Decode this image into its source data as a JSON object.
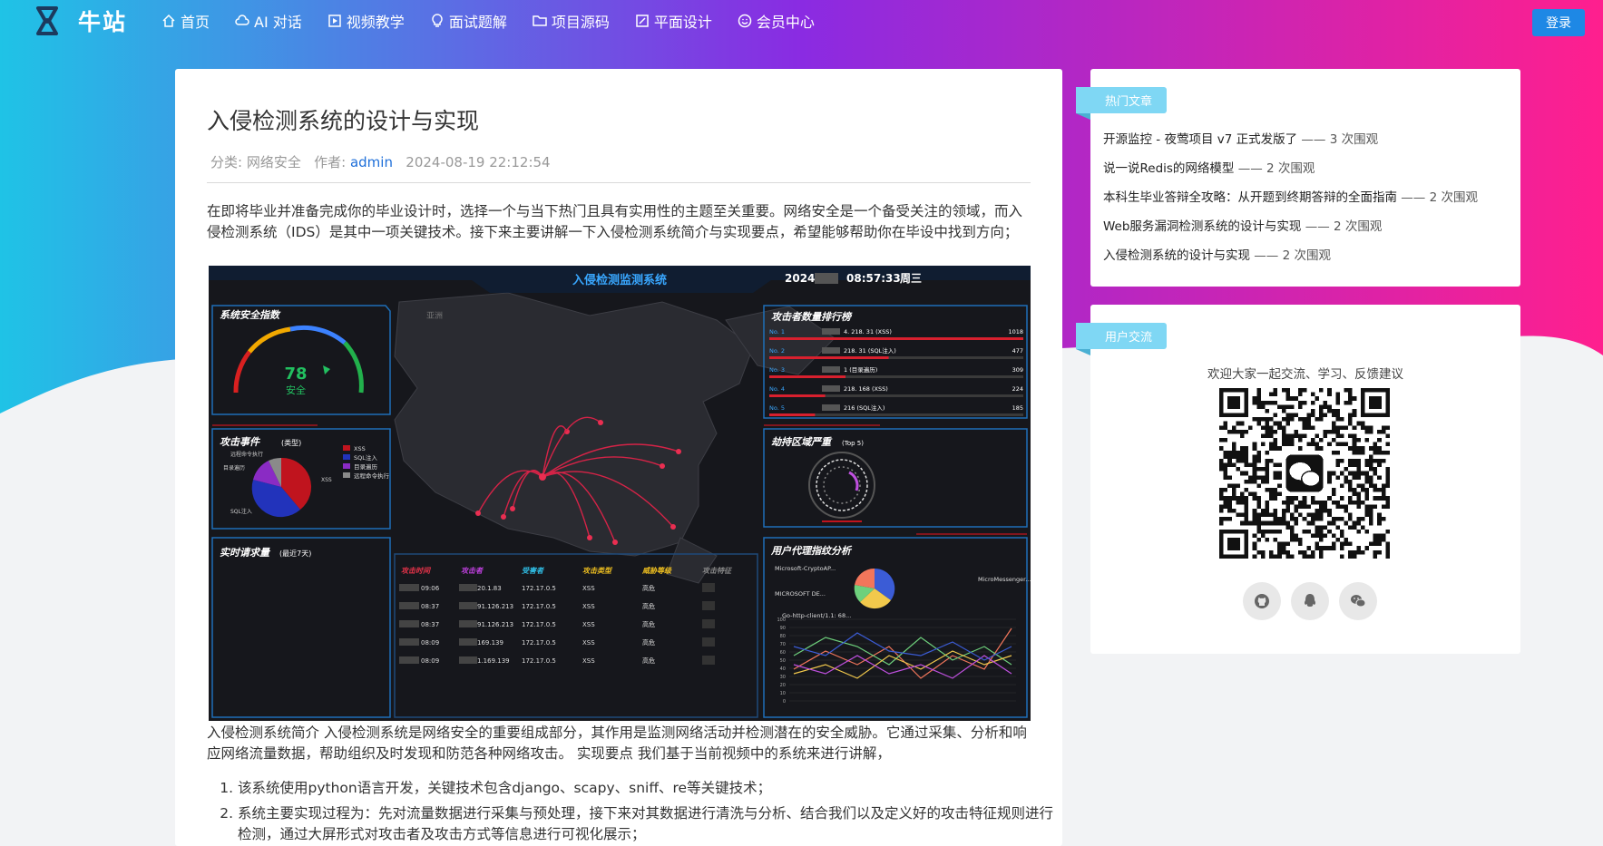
{
  "brand": {
    "name": "牛站"
  },
  "nav": {
    "items": [
      {
        "label": "首页",
        "icon": "home-icon"
      },
      {
        "label": "AI 对话",
        "icon": "cloud-icon"
      },
      {
        "label": "视频教学",
        "icon": "play-icon"
      },
      {
        "label": "面试题解",
        "icon": "bulb-icon"
      },
      {
        "label": "项目源码",
        "icon": "folder-icon"
      },
      {
        "label": "平面设计",
        "icon": "edit-icon"
      },
      {
        "label": "会员中心",
        "icon": "smile-icon"
      }
    ],
    "login": "登录"
  },
  "article": {
    "title": "入侵检测系统的设计与实现",
    "category_label": "分类: 网络安全",
    "author_label": "作者: ",
    "author": "admin",
    "date": "2024-08-19 22:12:54",
    "intro": "在即将毕业并准备完成你的毕业设计时，选择一个与当下热门且具有实用性的主题至关重要。网络安全是一个备受关注的领域，而入侵检测系统（IDS）是其中一项关键技术。接下来主要讲解一下入侵检测系统简介与实现要点，希望能够帮助你在毕设中找到方向；",
    "body": "入侵检测系统简介 入侵检测系统是网络安全的重要组成部分，其作用是监测网络活动并检测潜在的安全威胁。它通过采集、分析和响应网络流量数据，帮助组织及时发现和防范各种网络攻击。 实现要点 我们基于当前视频中的系统来进行讲解，",
    "steps": [
      "该系统使用python语言开发，关键技术包含django、scapy、sniff、re等关键技术；",
      "系统主要实现过程为：先对流量数据进行采集与预处理，接下来对其数据进行清洗与分析、结合我们以及定义好的攻击特征规则进行检测，通过大屏形式对攻击者及攻击方式等信息进行可视化展示；"
    ]
  },
  "dashboard": {
    "title": "入侵检测监测系统",
    "clock_year": "2024",
    "clock_time": "08:57:33",
    "clock_day": "周三",
    "map_label": "亚洲",
    "panel_index": "系统安全指数",
    "gauge_value": 78,
    "gauge_value_text": "78",
    "gauge_status": "安全",
    "panel_rank": "攻击者数量排行榜",
    "rank": [
      {
        "no": "No. 1",
        "ip": "4. 218. 31 (XSS)",
        "count": "1018",
        "fill": 1.0
      },
      {
        "no": "No. 2",
        "ip": "218. 31 (SQL注入)",
        "count": "477",
        "fill": 0.47
      },
      {
        "no": "No. 3",
        "ip": "1 (目录遍历)",
        "count": "309",
        "fill": 0.3
      },
      {
        "no": "No. 4",
        "ip": "218. 168 (XSS)",
        "count": "224",
        "fill": 0.22
      },
      {
        "no": "No. 5",
        "ip": "216 (SQL注入)",
        "count": "185",
        "fill": 0.18
      }
    ],
    "panel_events": "攻击事件",
    "panel_events_sub": "(类型)",
    "pie_labels": [
      "远程命令执行",
      "目录遍历",
      "XSS",
      "SQL注入"
    ],
    "legend": [
      {
        "name": "XSS",
        "color": "#c0141e"
      },
      {
        "name": "SQL注入",
        "color": "#2233bb"
      },
      {
        "name": "目录遍历",
        "color": "#8a2bc4"
      },
      {
        "name": "远程命令执行",
        "color": "#8a8a8a"
      }
    ],
    "panel_region": "劫持区域严重",
    "panel_region_sub": "(Top 5)",
    "panel_realtime": "实时请求量",
    "panel_realtime_sub": "(最近7天)",
    "table_headers": [
      "攻击时间",
      "攻击者",
      "受害者",
      "攻击类型",
      "威胁等级",
      "攻击特征"
    ],
    "table_header_colors": [
      "#e8334a",
      "#c040e0",
      "#30c0e8",
      "#f0c020",
      "#f0c020",
      "#888888"
    ],
    "table_rows": [
      [
        "09:06",
        "20.1.83",
        "172.17.0.5",
        "XSS",
        "高危"
      ],
      [
        "08:37",
        "91.126.213",
        "172.17.0.5",
        "XSS",
        "高危"
      ],
      [
        "08:37",
        "91.126.213",
        "172.17.0.5",
        "XSS",
        "高危"
      ],
      [
        "08:09",
        "169.139",
        "172.17.0.5",
        "XSS",
        "高危"
      ],
      [
        "08:09",
        "1.169.139",
        "172.17.0.5",
        "XSS",
        "高危"
      ]
    ],
    "panel_ua": "用户代理指纹分析",
    "ua_labels": [
      "Microsoft-CryptoAP...",
      "MICROSOFT DE...",
      "Go-http-client/1.1: 68...",
      "MicroMessenger..."
    ],
    "line_ticks": [
      "100",
      "90",
      "80",
      "70",
      "60",
      "50",
      "40",
      "30",
      "20",
      "10",
      "0"
    ]
  },
  "sidebar": {
    "hot": {
      "tag": "热门文章",
      "items": [
        {
          "title": "开源监控 - 夜莺项目 v7 正式发版了",
          "views": " —— 3 次围观"
        },
        {
          "title": "说一说Redis的网络模型",
          "views": " —— 2 次围观"
        },
        {
          "title": "本科生毕业答辩全攻略：从开题到终期答辩的全面指南",
          "views": " —— 2 次围观"
        },
        {
          "title": "Web服务漏洞检测系统的设计与实现",
          "views": " —— 2 次围观"
        },
        {
          "title": "入侵检测系统的设计与实现",
          "views": " —— 2 次围观"
        }
      ]
    },
    "user": {
      "tag": "用户交流",
      "desc": "欢迎大家一起交流、学习、反馈建议",
      "social": [
        "github-icon",
        "qq-icon",
        "wechat-icon"
      ]
    }
  },
  "colors": {
    "header_from": "#1fc3e6",
    "header_mid": "#8a2be2",
    "header_to": "#ff1f8e",
    "accent": "#1e88e5",
    "tag": "#7fd7f4"
  }
}
